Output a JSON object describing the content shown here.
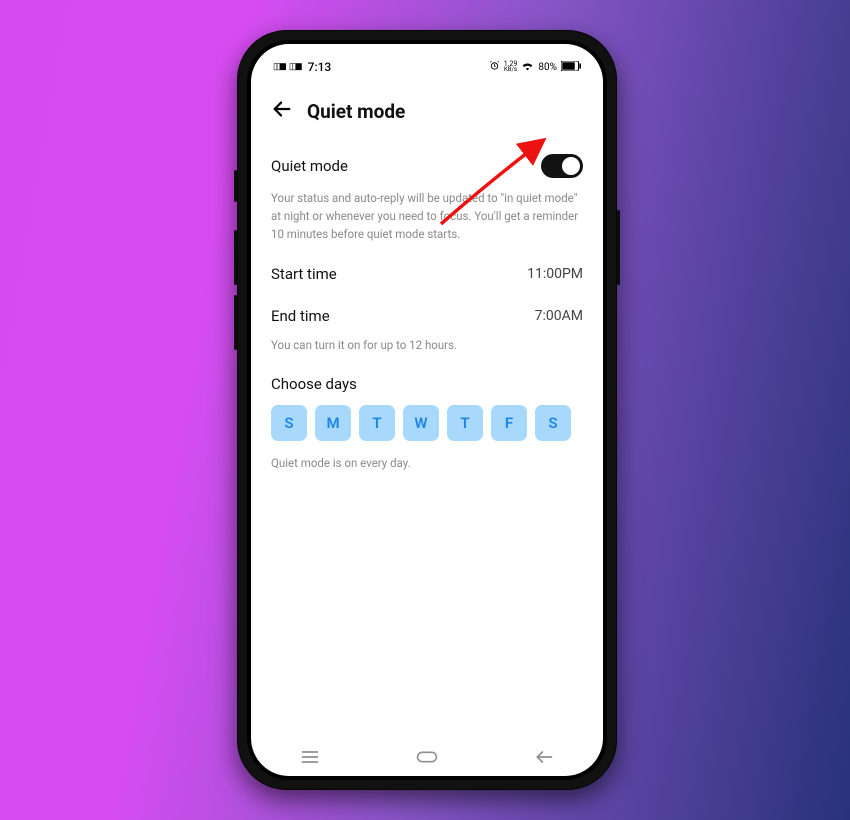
{
  "status": {
    "time": "7:13",
    "battery_pct": "80%",
    "net_rate_num": "1.29",
    "net_rate_unit": "KB/s"
  },
  "header": {
    "title": "Quiet mode"
  },
  "quiet_mode": {
    "label": "Quiet mode",
    "enabled": true,
    "description": "Your status and auto-reply will be updated to \"in quiet mode\" at night or whenever you need to focus. You'll get a reminder 10 minutes before quiet mode starts."
  },
  "start_time": {
    "label": "Start time",
    "value": "11:00PM"
  },
  "end_time": {
    "label": "End time",
    "value": "7:00AM"
  },
  "duration_note": "You can turn it on for up to 12 hours.",
  "choose_days": {
    "label": "Choose days",
    "days": [
      "S",
      "M",
      "T",
      "W",
      "T",
      "F",
      "S"
    ],
    "note": "Quiet mode is on every day."
  }
}
